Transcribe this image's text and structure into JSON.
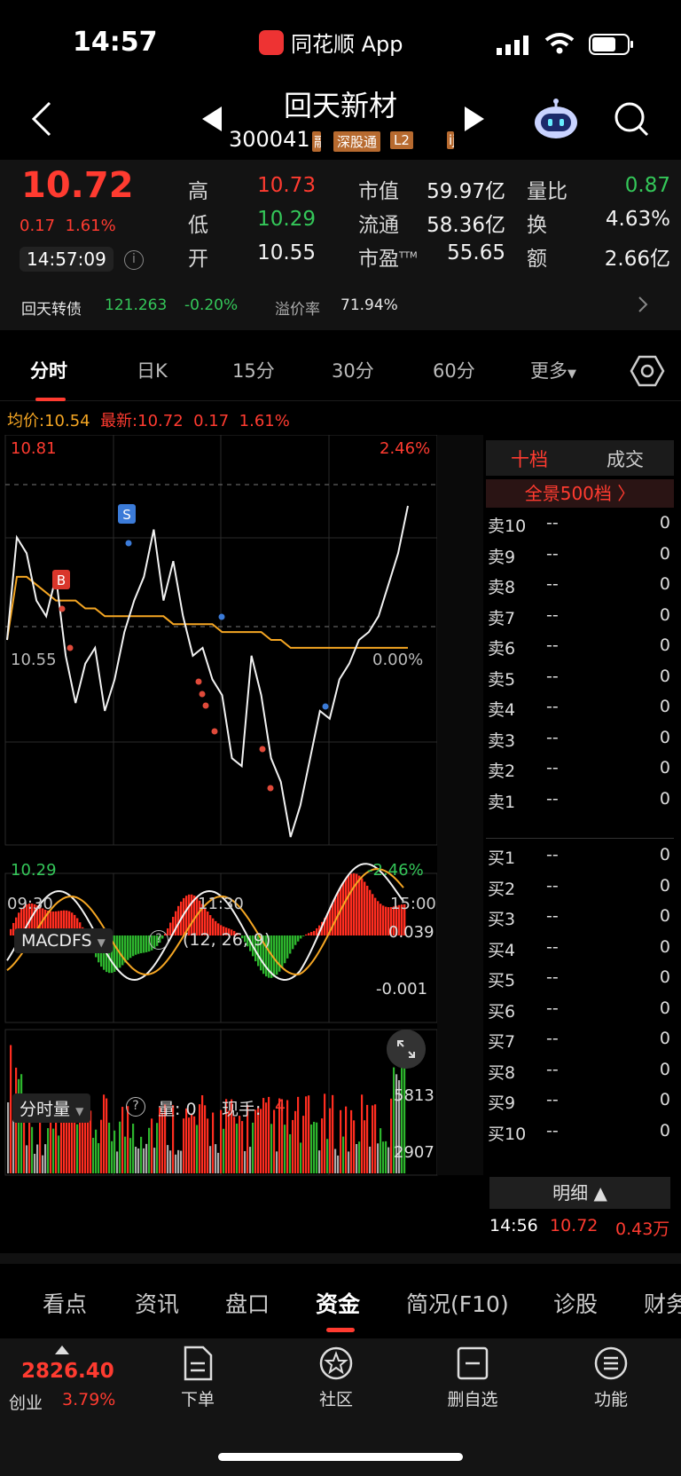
{
  "status": {
    "time": "14:57",
    "app": "同花顺 App"
  },
  "header": {
    "name": "回天新材",
    "code": "300041",
    "tags": [
      "融",
      "深股通",
      "L2",
      "ij"
    ]
  },
  "quote": {
    "last": "10.72",
    "change": "0.17",
    "change_pct": "1.61%",
    "time": "14:57:09",
    "high_label": "高",
    "high": "10.73",
    "low_label": "低",
    "low": "10.29",
    "open_label": "开",
    "open": "10.55",
    "mktcap_label": "市值",
    "mktcap": "59.97亿",
    "float_label": "流通",
    "float": "58.36亿",
    "pe_label": "市盈",
    "pe_sup": "TTM",
    "pe": "55.65",
    "vr_label": "量比",
    "vr": "0.87",
    "turnover_label": "换",
    "turnover": "4.63%",
    "amount_label": "额",
    "amount": "2.66亿"
  },
  "convertible": {
    "label": "回天转债",
    "price": "121.263",
    "change": "-0.20%",
    "premium_label": "溢价率",
    "premium": "71.94%"
  },
  "chart_tabs": [
    "分时",
    "日K",
    "15分",
    "30分",
    "60分",
    "更多"
  ],
  "avg": {
    "label": "均价:",
    "value": "10.54",
    "latest_label": "最新:",
    "latest": "10.72",
    "change": "0.17",
    "change_pct": "1.61%"
  },
  "chart_data": {
    "type": "line",
    "title": "",
    "y_axis": {
      "high": "10.81",
      "mid": "10.55",
      "low": "10.29",
      "high_pct": "2.46%",
      "mid_pct": "0.00%",
      "low_pct": "-2.46%"
    },
    "x_axis": [
      "09:30",
      "11:30",
      "15:00"
    ],
    "series": [
      {
        "name": "",
        "values": [
          10.55,
          10.68,
          10.66,
          10.6,
          10.58,
          10.63,
          10.53,
          10.47,
          10.52,
          10.54,
          10.46,
          10.5,
          10.56,
          10.6,
          10.63,
          10.69,
          10.6,
          10.65,
          10.58,
          10.53,
          10.54,
          10.5,
          10.48,
          10.4,
          10.39,
          10.53,
          10.48,
          10.4,
          10.37,
          10.3,
          10.34,
          10.4,
          10.46,
          10.45,
          10.5,
          10.52,
          10.55,
          10.56,
          10.58,
          10.62,
          10.66,
          10.72
        ]
      },
      {
        "name": "",
        "values": [
          10.55,
          10.63,
          10.63,
          10.62,
          10.61,
          10.6,
          10.6,
          10.6,
          10.59,
          10.59,
          10.58,
          10.58,
          10.58,
          10.58,
          10.58,
          10.58,
          10.58,
          10.57,
          10.57,
          10.57,
          10.57,
          10.57,
          10.56,
          10.56,
          10.56,
          10.56,
          10.56,
          10.55,
          10.55,
          10.54,
          10.54,
          10.54,
          10.54,
          10.54,
          10.54,
          10.54,
          10.54,
          10.54,
          10.54,
          10.54,
          10.54,
          10.54
        ]
      }
    ],
    "markers": [
      "S",
      "B"
    ]
  },
  "macd": {
    "label": "MACDFS",
    "params": "(12, 26, 9)",
    "top": "0.039",
    "mid": "-0.001"
  },
  "volume": {
    "label": "分时量",
    "qty_label": "量: 0",
    "hand_label": "现手:",
    "hand": "4",
    "top": "5813",
    "mid": "2907"
  },
  "orderbook": {
    "tab1": "十档",
    "tab2": "成交",
    "full": "全景500档 〉",
    "sell": [
      {
        "label": "卖10",
        "price": "--",
        "vol": "0"
      },
      {
        "label": "卖9",
        "price": "--",
        "vol": "0"
      },
      {
        "label": "卖8",
        "price": "--",
        "vol": "0"
      },
      {
        "label": "卖7",
        "price": "--",
        "vol": "0"
      },
      {
        "label": "卖6",
        "price": "--",
        "vol": "0"
      },
      {
        "label": "卖5",
        "price": "--",
        "vol": "0"
      },
      {
        "label": "卖4",
        "price": "--",
        "vol": "0"
      },
      {
        "label": "卖3",
        "price": "--",
        "vol": "0"
      },
      {
        "label": "卖2",
        "price": "--",
        "vol": "0"
      },
      {
        "label": "卖1",
        "price": "--",
        "vol": "0"
      }
    ],
    "buy": [
      {
        "label": "买1",
        "price": "--",
        "vol": "0"
      },
      {
        "label": "买2",
        "price": "--",
        "vol": "0"
      },
      {
        "label": "买3",
        "price": "--",
        "vol": "0"
      },
      {
        "label": "买4",
        "price": "--",
        "vol": "0"
      },
      {
        "label": "买5",
        "price": "--",
        "vol": "0"
      },
      {
        "label": "买6",
        "price": "--",
        "vol": "0"
      },
      {
        "label": "买7",
        "price": "--",
        "vol": "0"
      },
      {
        "label": "买8",
        "price": "--",
        "vol": "0"
      },
      {
        "label": "买9",
        "price": "--",
        "vol": "0"
      },
      {
        "label": "买10",
        "price": "--",
        "vol": "0"
      }
    ],
    "detail": "明细 ▲",
    "last": {
      "time": "14:56",
      "price": "10.72",
      "vol": "0.43万"
    }
  },
  "bottom_tabs": [
    "看点",
    "资讯",
    "盘口",
    "资金",
    "简况(F10)",
    "诊股",
    "财务"
  ],
  "index": {
    "value": "2826.40",
    "name": "创业",
    "change": "3.79%"
  },
  "nav": [
    "下单",
    "社区",
    "删自选",
    "功能"
  ],
  "colors": {
    "up": "#ff3b30",
    "down": "#34c759",
    "avg": "#f5a623"
  }
}
